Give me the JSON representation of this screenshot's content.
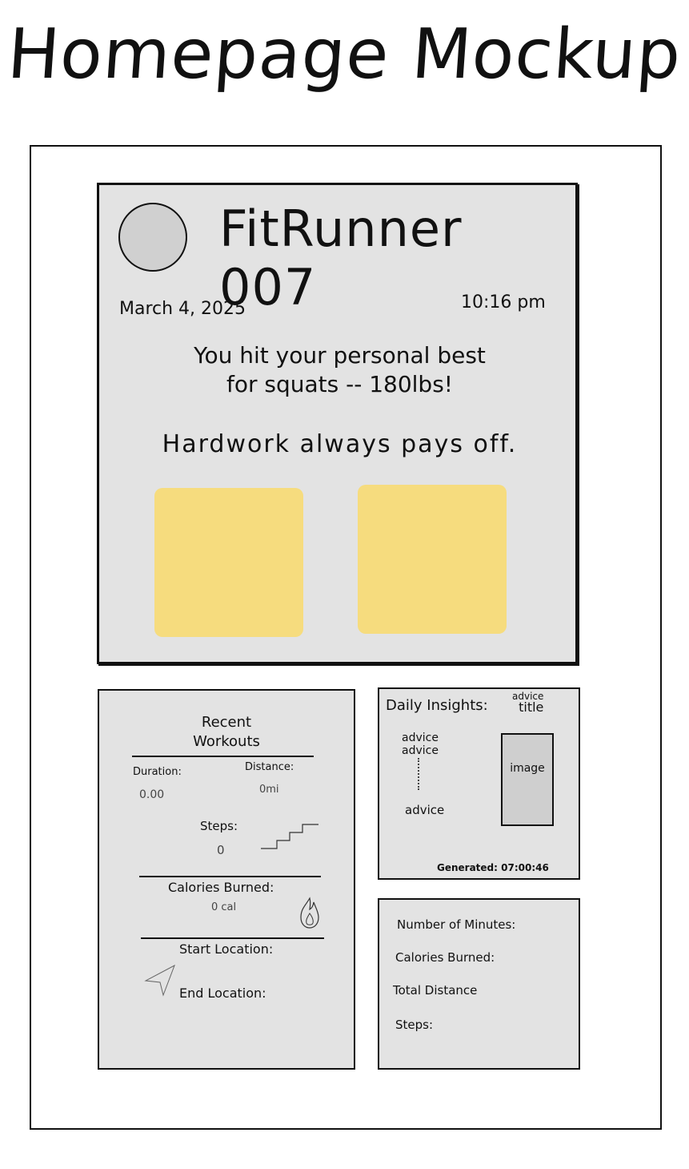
{
  "page": {
    "title": "Homepage Mockup"
  },
  "profile": {
    "username": "FitRunner 007",
    "date": "March 4, 2025",
    "time": "10:16 pm",
    "message_line1": "You hit your personal best",
    "message_line2": "for squats -- 180lbs!",
    "motto": "Hardwork always pays off."
  },
  "recent_workouts": {
    "title_line1": "Recent",
    "title_line2": "Workouts",
    "duration_label": "Duration:",
    "duration_value": "0.00",
    "distance_label": "Distance:",
    "distance_value": "0mi",
    "steps_label": "Steps:",
    "steps_value": "0",
    "calories_label": "Calories Burned:",
    "calories_value": "0 cal",
    "start_location_label": "Start Location:",
    "end_location_label": "End Location:"
  },
  "daily_insights": {
    "heading": "Daily Insights:",
    "advice_title_line1": "advice",
    "advice_title_line2": "title",
    "advice_1": "advice",
    "advice_2": "advice",
    "advice_3": "advice",
    "image_label": "image",
    "generated": "Generated: 07:00:46"
  },
  "summary": {
    "minutes_label": "Number of Minutes:",
    "calories_label": "Calories Burned:",
    "distance_label": "Total Distance",
    "steps_label": "Steps:"
  },
  "colors": {
    "card_bg": "#e3e3e3",
    "tile_yellow": "#f6dc7e",
    "avatar_gray": "#d0d0d0"
  },
  "icons": [
    "avatar",
    "stairs-icon",
    "flame-icon",
    "navigation-arrow-icon"
  ]
}
